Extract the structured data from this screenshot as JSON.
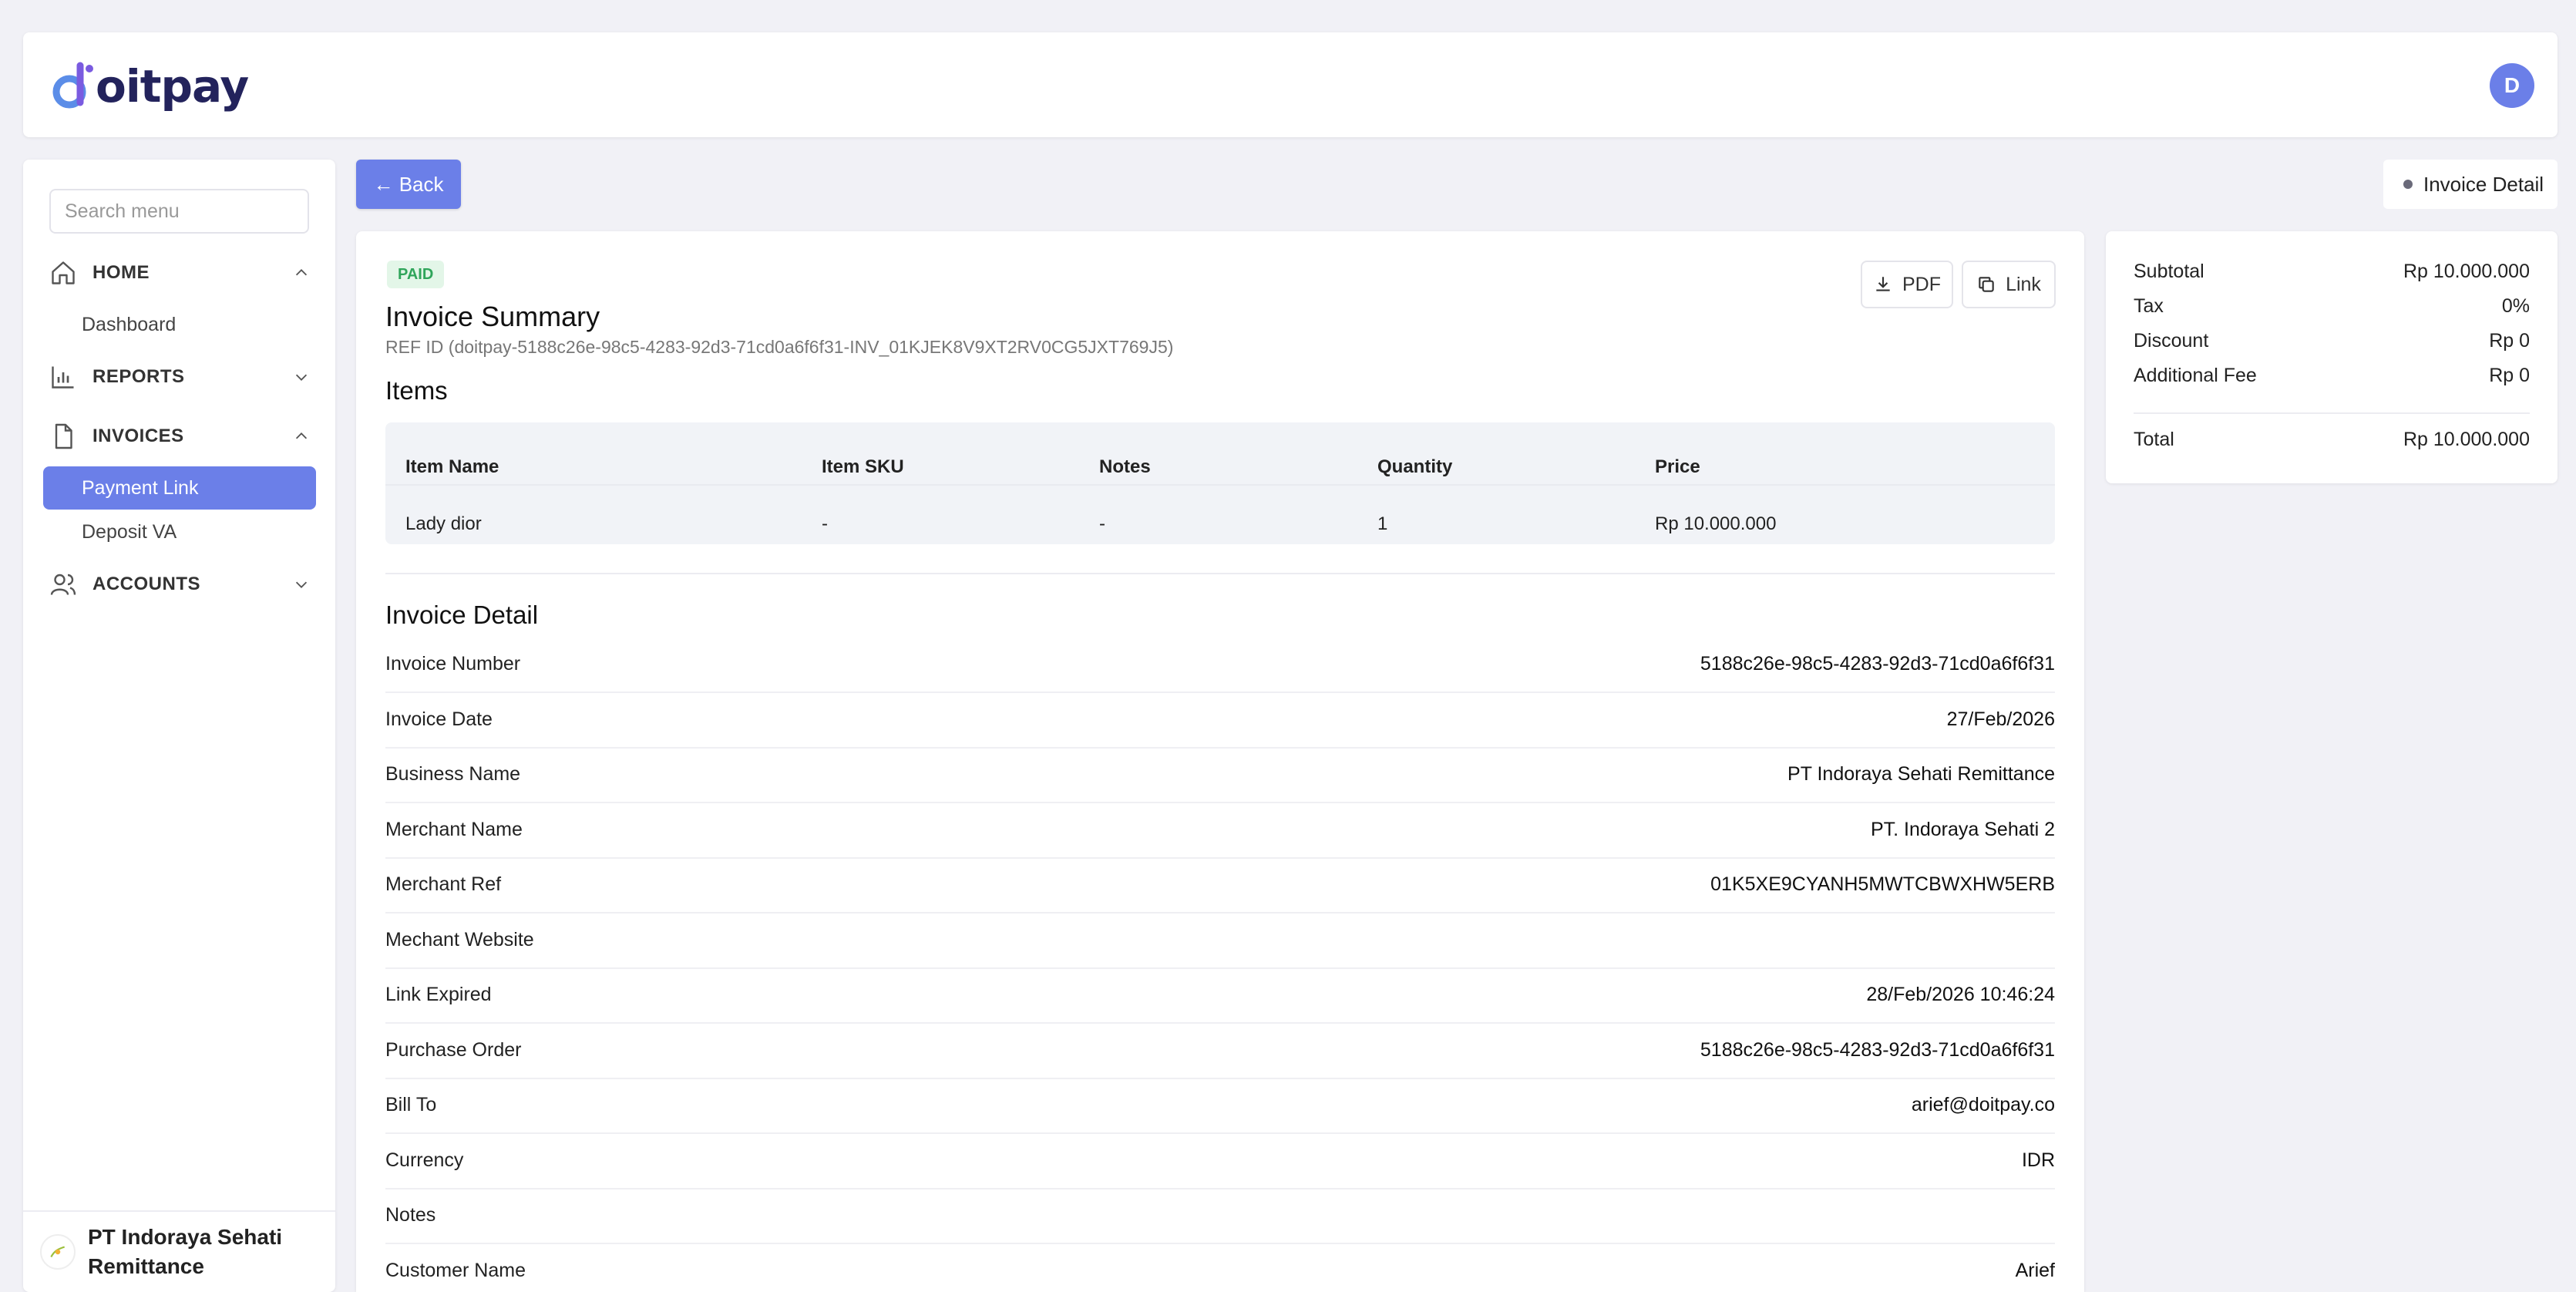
{
  "brand": {
    "name": "oitpay",
    "user_initial": "D"
  },
  "sidebar": {
    "search_placeholder": "Search menu",
    "groups": [
      {
        "label": "HOME",
        "items": [
          "Dashboard"
        ]
      },
      {
        "label": "REPORTS"
      },
      {
        "label": "INVOICES",
        "items": [
          "Payment Link",
          "Deposit VA"
        ]
      },
      {
        "label": "ACCOUNTS"
      }
    ],
    "org_name": "PT Indoraya Sehati Remittance"
  },
  "toolbar": {
    "back_label": "← Back",
    "breadcrumb": "Invoice Detail"
  },
  "invoice": {
    "status": "PAID",
    "title": "Invoice Summary",
    "ref": "REF ID (doitpay-5188c26e-98c5-4283-92d3-71cd0a6f6f31-INV_01KJEK8V9XT2RV0CG5JXT769J5)",
    "pdf_label": "PDF",
    "link_label": "Link",
    "items_heading": "Items",
    "columns": [
      "Item Name",
      "Item SKU",
      "Notes",
      "Quantity",
      "Price"
    ],
    "rows": [
      [
        "Lady dior",
        "-",
        "-",
        "1",
        "Rp 10.000.000"
      ]
    ],
    "detail_heading": "Invoice Detail",
    "details": [
      {
        "label": "Invoice Number",
        "value": "5188c26e-98c5-4283-92d3-71cd0a6f6f31"
      },
      {
        "label": "Invoice Date",
        "value": "27/Feb/2026"
      },
      {
        "label": "Business Name",
        "value": "PT Indoraya Sehati Remittance"
      },
      {
        "label": "Merchant Name",
        "value": "PT. Indoraya Sehati 2"
      },
      {
        "label": "Merchant Ref",
        "value": "01K5XE9CYANH5MWTCBWXHW5ERB"
      },
      {
        "label": "Mechant Website",
        "value": ""
      },
      {
        "label": "Link Expired",
        "value": "28/Feb/2026 10:46:24"
      },
      {
        "label": "Purchase Order",
        "value": "5188c26e-98c5-4283-92d3-71cd0a6f6f31"
      },
      {
        "label": "Bill To",
        "value": "arief@doitpay.co"
      },
      {
        "label": "Currency",
        "value": "IDR"
      },
      {
        "label": "Notes",
        "value": ""
      },
      {
        "label": "Customer Name",
        "value": "Arief"
      }
    ]
  },
  "summary": {
    "rows": [
      {
        "label": "Subtotal",
        "value": "Rp 10.000.000"
      },
      {
        "label": "Tax",
        "value": "0%"
      },
      {
        "label": "Discount",
        "value": "Rp 0"
      },
      {
        "label": "Additional Fee",
        "value": "Rp 0"
      }
    ],
    "total_label": "Total",
    "total_value": "Rp 10.000.000"
  },
  "colors": {
    "accent": "#6b7fe8",
    "paid_bg": "#e3f6e8",
    "paid_text": "#2fa55a"
  }
}
